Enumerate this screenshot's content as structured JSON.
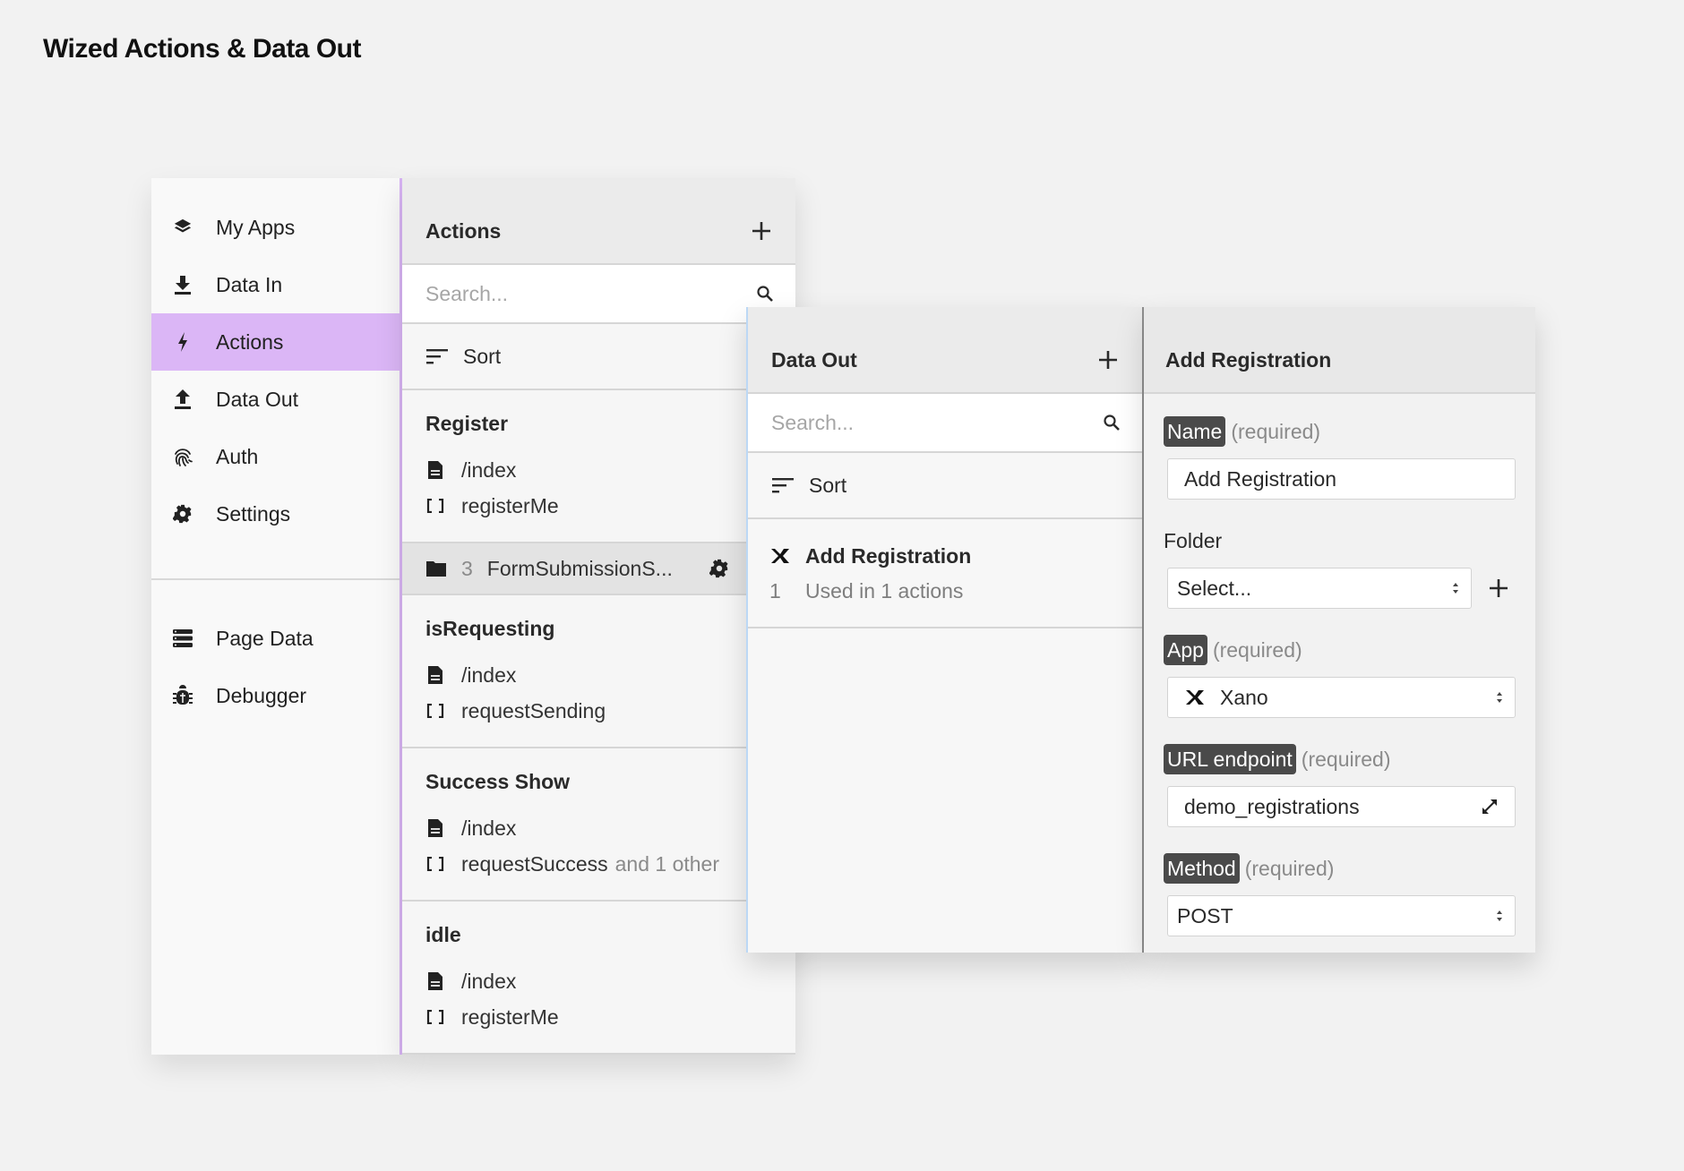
{
  "page": {
    "title": "Wized Actions & Data Out"
  },
  "colors": {
    "accent_purple": "#dbb6f6",
    "accent_border": "#d7b3f3",
    "dataout_border": "#bcd8f5",
    "tag_bg": "#4a4a4a"
  },
  "sidebar": {
    "items": [
      {
        "label": "My Apps",
        "icon": "layers-icon",
        "active": false
      },
      {
        "label": "Data In",
        "icon": "download-icon",
        "active": false
      },
      {
        "label": "Actions",
        "icon": "lightning-icon",
        "active": true
      },
      {
        "label": "Data Out",
        "icon": "upload-icon",
        "active": false
      },
      {
        "label": "Auth",
        "icon": "fingerprint-icon",
        "active": false
      },
      {
        "label": "Settings",
        "icon": "gear-icon",
        "active": false
      }
    ],
    "secondary_items": [
      {
        "label": "Page Data",
        "icon": "database-icon"
      },
      {
        "label": "Debugger",
        "icon": "bug-icon"
      }
    ]
  },
  "actions_panel": {
    "title": "Actions",
    "search_placeholder": "Search...",
    "sort_label": "Sort",
    "groups": [
      {
        "title": "Register",
        "page": "/index",
        "variable": "registerMe",
        "extra": ""
      },
      {
        "title": "isRequesting",
        "page": "/index",
        "variable": "requestSending",
        "extra": ""
      },
      {
        "title": "Success Show",
        "page": "/index",
        "variable": "requestSuccess",
        "extra": "and 1 other"
      },
      {
        "title": "idle",
        "page": "/index",
        "variable": "registerMe",
        "extra": ""
      }
    ],
    "folder": {
      "count": "3",
      "name": "FormSubmissionS..."
    }
  },
  "dataout_panel": {
    "title": "Data Out",
    "search_placeholder": "Search...",
    "sort_label": "Sort",
    "items": [
      {
        "name": "Add Registration",
        "index": "1",
        "usage": "Used in 1 actions",
        "app_icon": "xano-icon"
      }
    ]
  },
  "detail_panel": {
    "title": "Add Registration",
    "fields": {
      "name": {
        "label": "Name",
        "required": "(required)",
        "value": "Add Registration"
      },
      "folder": {
        "label": "Folder",
        "value": "Select..."
      },
      "app": {
        "label": "App",
        "required": "(required)",
        "value": "Xano"
      },
      "url": {
        "label": "URL endpoint",
        "required": "(required)",
        "value": "demo_registrations"
      },
      "method": {
        "label": "Method",
        "required": "(required)",
        "value": "POST"
      }
    }
  }
}
